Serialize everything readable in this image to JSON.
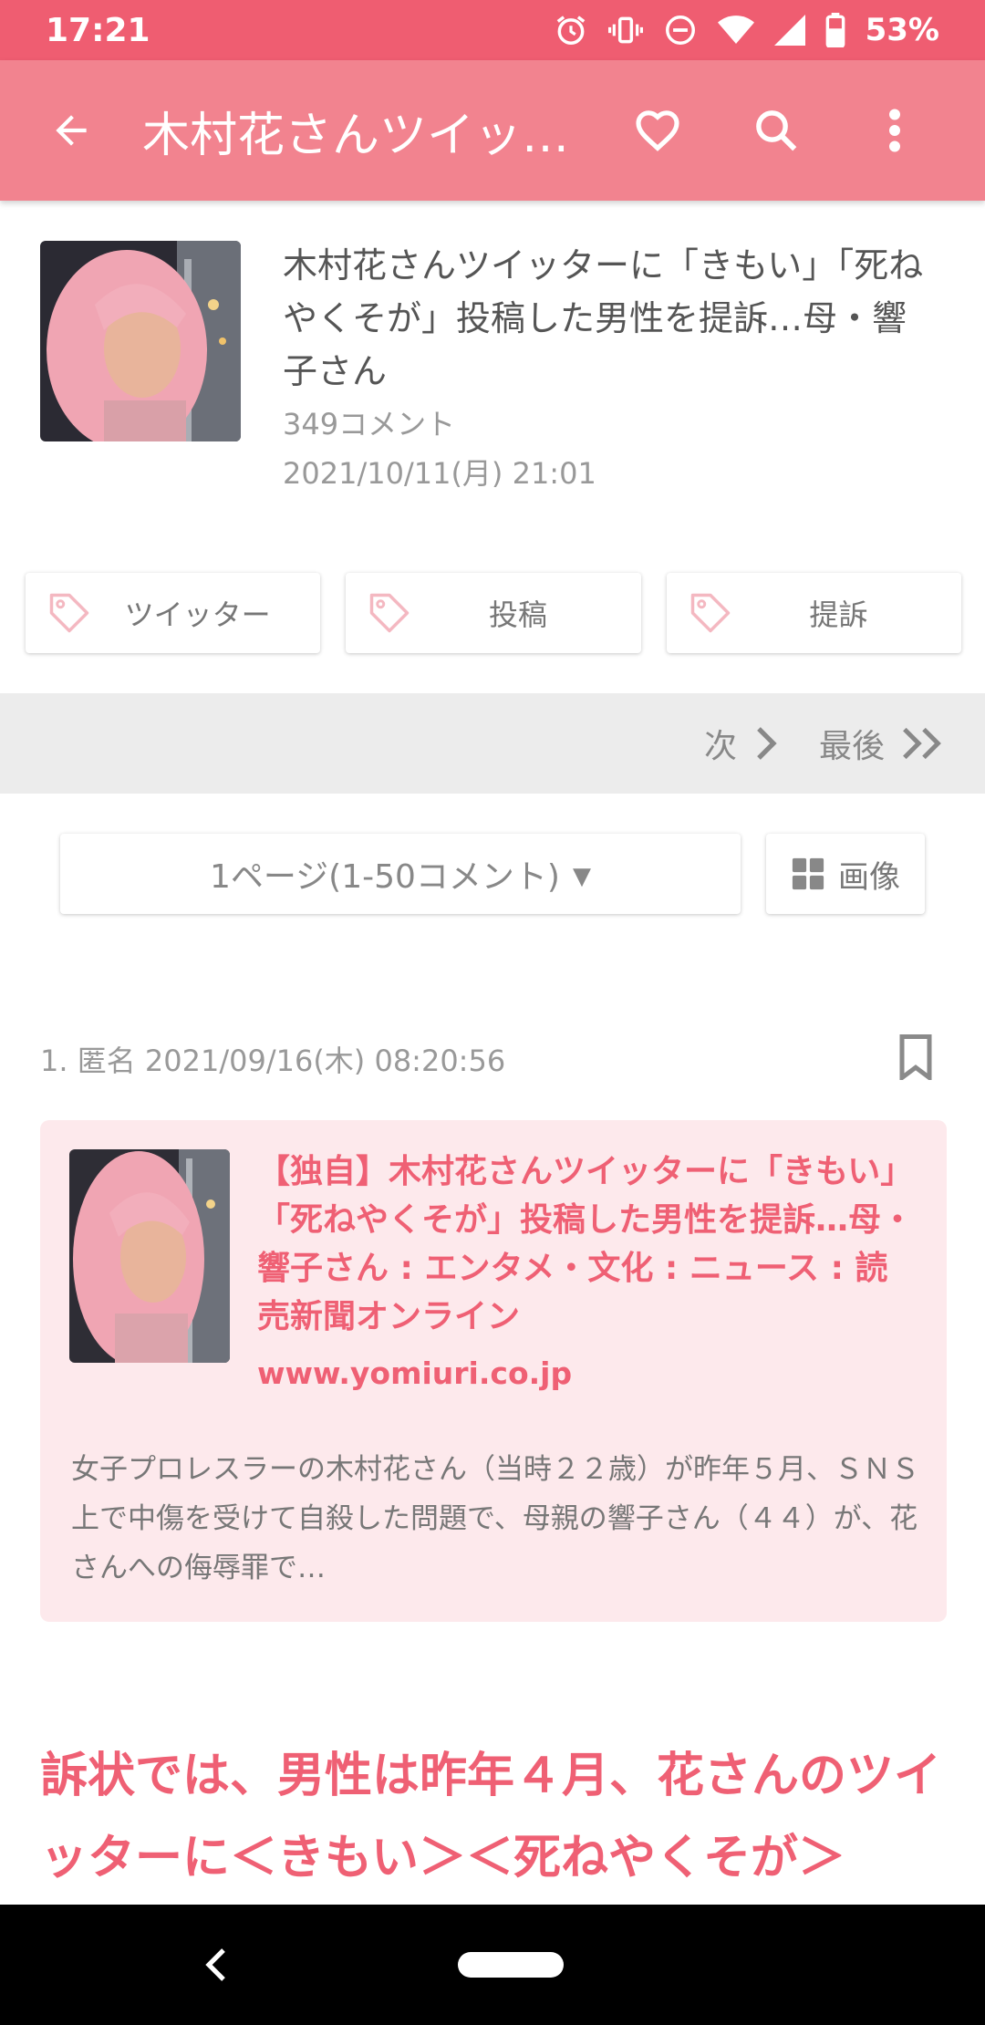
{
  "status": {
    "time": "17:21",
    "battery": "53%"
  },
  "appbar": {
    "title": "木村花さんツイッ…",
    "icons": [
      "back-arrow-icon",
      "heart-icon",
      "search-icon",
      "more-vert-icon"
    ]
  },
  "article": {
    "headline": "木村花さんツイッターに「きもい」「死ねやくそが」投稿した男性を提訴…母・響子さん",
    "comments": "349コメント",
    "date": "2021/10/11(月) 21:01"
  },
  "tags": [
    "ツイッター",
    "投稿",
    "提訴"
  ],
  "pager": {
    "next": "次",
    "last": "最後"
  },
  "page_select": {
    "value": "1ページ(1-50コメント)",
    "caret": "▼"
  },
  "image_button": "画像",
  "comment": {
    "meta": "1. 匿名 2021/09/16(木) 08:20:56",
    "card": {
      "title": "【独自】木村花さんツイッターに「きもい」「死ねやくそが」投稿した男性を提訴…母・響子さん : エンタメ・文化 : ニュース : 読売新聞オンライン",
      "domain": "www.yomiuri.co.jp",
      "description": "女子プロレスラーの木村花さん（当時２２歳）が昨年５月、ＳＮＳ上で中傷を受けて自殺した問題で、母親の響子さん（４４）が、花さんへの侮辱罪で…"
    },
    "quote": "訴状では、男性は昨年４月、花さんのツイッターに＜きもい＞＜死ねやくそが＞"
  },
  "colors": {
    "statusbar": "#ef5d71",
    "appbar": "#f2838f",
    "accent": "#ef6074",
    "card_bg": "#fde9ec"
  }
}
